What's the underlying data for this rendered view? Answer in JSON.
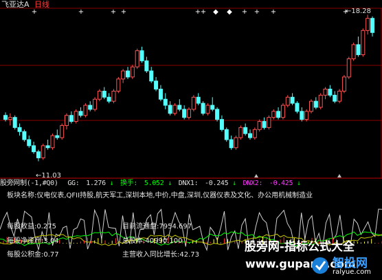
{
  "title": {
    "stock_name": "飞亚达A",
    "period": "日线"
  },
  "price_labels": {
    "high": "18.28",
    "low": "11.03"
  },
  "indicator": {
    "name": "股旁网制(-1,#Q0)",
    "gg_label": "GG:",
    "gg_value": "1.276",
    "turnover_label": "换手:",
    "turnover_value": "5.052",
    "dnx1_label": "DNX1:",
    "dnx1_value": "-0.245",
    "dnx2_label": "DNX2:",
    "dnx2_value": "-0.425"
  },
  "info": {
    "sector": "板块名称:仪电仪表,QFII持股,航天军工,深圳本地,中价,中盘,深圳,仪器仪表及文化、办公用机械制造业",
    "eps": "每股收益:0.275",
    "float_shares": "目前流通盘:7954.697",
    "nav": "每股净资产:3.04",
    "total_shares": "总股本:40990.100",
    "reserve": "每股公积金:0.77",
    "revenue_growth": "主营收入同比增长:42.73"
  },
  "watermark": {
    "site_name": "股旁网-指标公式大全",
    "url": "www.gupang.com",
    "logo_text": "智投网",
    "logo_url": "ralyue.com"
  },
  "colors": {
    "up": "#ff5454",
    "down": "#54ffff",
    "grid": "#8b0000",
    "text": "#e0e0e0",
    "green_line": "#00ff00",
    "gray_line": "#d0d0d0"
  },
  "chart_data": {
    "type": "candlestick",
    "x_label": "",
    "y_label": "",
    "y_range": [
      10.5,
      18.6
    ],
    "high_marker": 18.28,
    "low_marker": 11.03,
    "candles": [
      [
        13.3,
        13.45,
        13.0,
        13.1
      ],
      [
        13.1,
        13.4,
        12.8,
        13.2
      ],
      [
        13.2,
        13.3,
        12.6,
        12.7
      ],
      [
        12.7,
        12.9,
        12.3,
        12.5
      ],
      [
        12.5,
        12.6,
        12.0,
        12.1
      ],
      [
        12.1,
        12.3,
        11.7,
        11.8
      ],
      [
        11.8,
        12.0,
        11.4,
        11.5
      ],
      [
        11.5,
        11.6,
        11.03,
        11.2
      ],
      [
        11.2,
        11.9,
        11.1,
        11.8
      ],
      [
        11.8,
        12.1,
        11.6,
        11.7
      ],
      [
        11.7,
        12.4,
        11.6,
        12.3
      ],
      [
        12.3,
        12.6,
        12.1,
        12.2
      ],
      [
        12.2,
        12.9,
        12.1,
        12.8
      ],
      [
        12.8,
        13.4,
        12.6,
        13.3
      ],
      [
        13.3,
        13.5,
        12.9,
        13.0
      ],
      [
        13.0,
        13.6,
        12.9,
        13.5
      ],
      [
        13.5,
        13.7,
        13.2,
        13.3
      ],
      [
        13.3,
        13.9,
        13.2,
        13.8
      ],
      [
        13.8,
        14.0,
        13.5,
        13.6
      ],
      [
        13.6,
        14.2,
        13.5,
        14.1
      ],
      [
        14.1,
        14.6,
        14.0,
        14.5
      ],
      [
        14.5,
        14.7,
        14.1,
        14.2
      ],
      [
        14.2,
        14.4,
        13.9,
        14.0
      ],
      [
        14.0,
        14.6,
        13.9,
        14.5
      ],
      [
        14.5,
        15.2,
        14.4,
        15.1
      ],
      [
        15.1,
        15.6,
        14.9,
        15.5
      ],
      [
        15.5,
        15.7,
        15.1,
        15.2
      ],
      [
        15.2,
        15.8,
        15.1,
        15.7
      ],
      [
        15.7,
        16.6,
        15.6,
        16.5
      ],
      [
        16.5,
        16.7,
        15.9,
        16.0
      ],
      [
        16.0,
        16.2,
        15.4,
        15.5
      ],
      [
        15.5,
        15.7,
        14.9,
        15.0
      ],
      [
        15.0,
        15.2,
        14.5,
        14.6
      ],
      [
        14.6,
        14.8,
        14.0,
        14.1
      ],
      [
        14.1,
        14.4,
        13.6,
        13.8
      ],
      [
        13.8,
        14.0,
        13.3,
        13.4
      ],
      [
        13.4,
        13.9,
        13.3,
        13.8
      ],
      [
        13.8,
        14.1,
        13.5,
        13.6
      ],
      [
        13.6,
        13.8,
        13.1,
        13.2
      ],
      [
        13.2,
        13.7,
        13.1,
        13.6
      ],
      [
        13.6,
        14.3,
        13.5,
        14.2
      ],
      [
        14.2,
        14.4,
        13.8,
        13.9
      ],
      [
        13.9,
        14.0,
        13.3,
        13.4
      ],
      [
        13.4,
        13.9,
        13.3,
        13.8
      ],
      [
        13.8,
        14.2,
        13.5,
        13.6
      ],
      [
        13.6,
        13.7,
        13.0,
        13.1
      ],
      [
        13.1,
        13.3,
        12.5,
        12.6
      ],
      [
        12.6,
        12.7,
        12.0,
        12.1
      ],
      [
        12.1,
        12.3,
        11.6,
        11.7
      ],
      [
        11.7,
        12.3,
        11.6,
        12.2
      ],
      [
        12.2,
        12.8,
        12.1,
        12.7
      ],
      [
        12.7,
        12.9,
        12.3,
        12.4
      ],
      [
        12.4,
        12.6,
        12.1,
        12.2
      ],
      [
        12.2,
        12.7,
        12.1,
        12.6
      ],
      [
        12.6,
        13.1,
        12.5,
        13.0
      ],
      [
        13.0,
        13.2,
        12.6,
        12.7
      ],
      [
        12.7,
        13.3,
        12.6,
        13.2
      ],
      [
        13.2,
        13.6,
        13.1,
        13.5
      ],
      [
        13.5,
        13.7,
        13.1,
        13.2
      ],
      [
        13.2,
        13.9,
        13.1,
        13.8
      ],
      [
        13.8,
        14.3,
        13.7,
        14.2
      ],
      [
        14.2,
        14.4,
        13.8,
        13.9
      ],
      [
        13.9,
        14.0,
        13.4,
        13.5
      ],
      [
        13.5,
        13.7,
        13.0,
        13.1
      ],
      [
        13.1,
        13.6,
        13.0,
        13.5
      ],
      [
        13.5,
        14.1,
        13.4,
        14.0
      ],
      [
        14.0,
        14.2,
        13.6,
        13.7
      ],
      [
        13.7,
        14.4,
        13.6,
        14.3
      ],
      [
        14.3,
        14.7,
        14.1,
        14.6
      ],
      [
        14.6,
        14.8,
        14.2,
        14.3
      ],
      [
        14.3,
        14.5,
        13.9,
        14.0
      ],
      [
        14.0,
        14.6,
        13.9,
        14.5
      ],
      [
        14.5,
        15.3,
        14.4,
        15.2
      ],
      [
        15.2,
        16.2,
        15.1,
        16.1
      ],
      [
        16.1,
        16.9,
        16.0,
        16.8
      ],
      [
        16.8,
        17.2,
        16.2,
        16.3
      ],
      [
        16.3,
        17.6,
        16.2,
        17.5
      ],
      [
        17.5,
        18.28,
        17.3,
        18.1
      ],
      [
        18.1,
        18.2,
        17.2,
        17.4
      ]
    ]
  }
}
